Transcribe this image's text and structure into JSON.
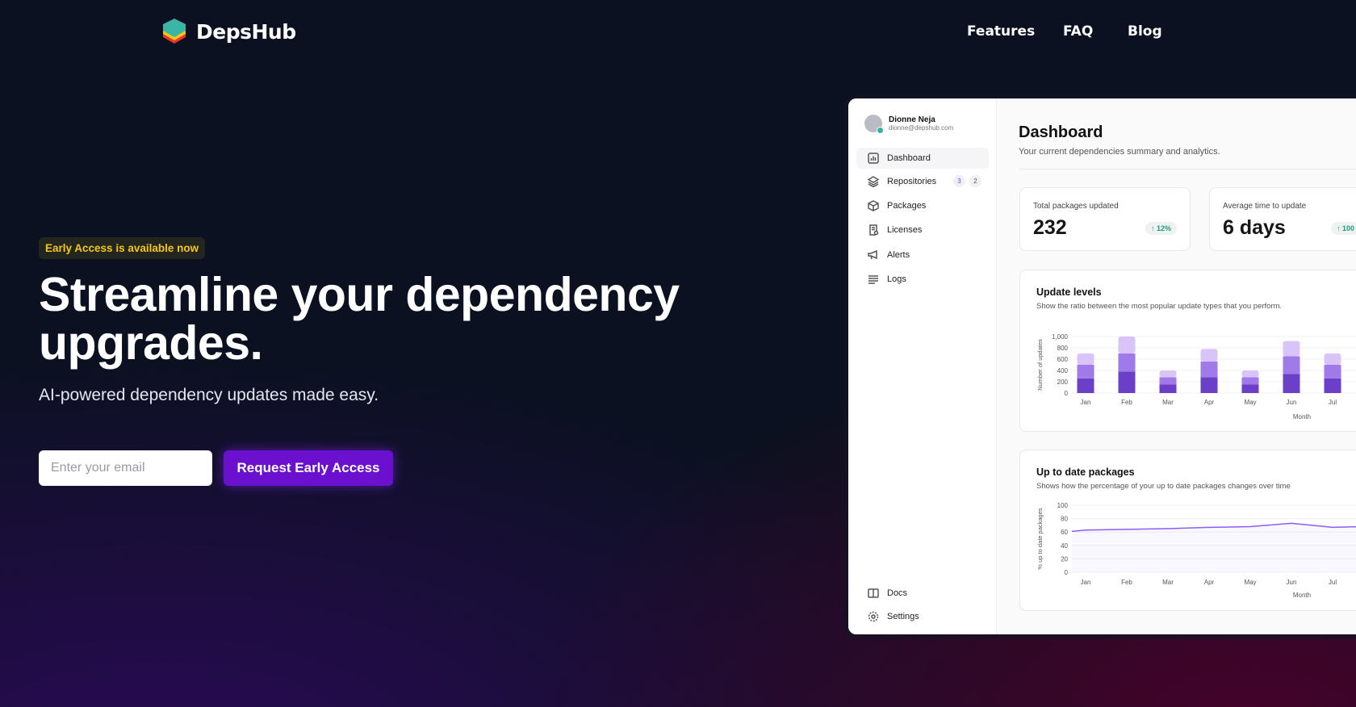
{
  "brand": {
    "name": "DepsHub",
    "logo_colors": [
      "#3bb5a5",
      "#f5c518",
      "#e8352a"
    ]
  },
  "nav": {
    "items": [
      "Features",
      "FAQ",
      "Blog"
    ]
  },
  "hero": {
    "badge": "Early Access is available now",
    "title_line1": "Streamline your dependency",
    "title_line2": "upgrades.",
    "subtitle": "AI-powered dependency updates made easy.",
    "email_placeholder": "Enter your email",
    "cta": "Request Early Access"
  },
  "colors": {
    "accent": "#6b10cf",
    "badge_text": "#f5c518",
    "bar_dark": "#6c3fc9",
    "bar_mid": "#a07ae8",
    "bar_light": "#d9c4f7",
    "line": "#8b5cf6"
  },
  "dashboard": {
    "user": {
      "name": "Dionne Neja",
      "email": "dionne@depshub.com"
    },
    "sidebar": [
      {
        "label": "Dashboard",
        "icon": "bar-chart-icon",
        "active": true
      },
      {
        "label": "Repositories",
        "icon": "layers-icon",
        "badges": [
          "3",
          "2"
        ]
      },
      {
        "label": "Packages",
        "icon": "package-icon"
      },
      {
        "label": "Licenses",
        "icon": "license-icon"
      },
      {
        "label": "Alerts",
        "icon": "megaphone-icon"
      },
      {
        "label": "Logs",
        "icon": "list-icon"
      }
    ],
    "sidebar_bottom": [
      {
        "label": "Docs",
        "icon": "book-icon"
      },
      {
        "label": "Settings",
        "icon": "gear-icon"
      }
    ],
    "title": "Dashboard",
    "subtitle": "Your current dependencies summary and analytics.",
    "stats": [
      {
        "label": "Total packages updated",
        "value": "232",
        "delta": "12%"
      },
      {
        "label": "Average time to update",
        "value": "6 days",
        "delta": "100"
      }
    ],
    "update_levels": {
      "title": "Update levels",
      "subtitle": "Show the ratio between the most popular update types that you perform."
    },
    "up_to_date": {
      "title": "Up to date packages",
      "subtitle": "Shows how the percentage of your up to date packages changes over time"
    }
  },
  "chart_data": [
    {
      "type": "bar",
      "stacked": true,
      "categories": [
        "Jan",
        "Feb",
        "Mar",
        "Apr",
        "May",
        "Jun",
        "Jul"
      ],
      "series": [
        {
          "values": [
            260,
            380,
            150,
            280,
            150,
            340,
            260
          ]
        },
        {
          "values": [
            240,
            320,
            130,
            280,
            130,
            310,
            240
          ]
        },
        {
          "values": [
            200,
            300,
            120,
            220,
            120,
            270,
            200
          ]
        }
      ],
      "xlabel": "Month",
      "ylabel": "Number of updates",
      "yticks": [
        "0",
        "200",
        "400",
        "600",
        "800",
        "1,000"
      ],
      "ylim": [
        0,
        1000
      ],
      "grid": true
    },
    {
      "type": "line",
      "categories": [
        "Jan",
        "Feb",
        "Mar",
        "Apr",
        "May",
        "Jun",
        "Jul"
      ],
      "series": [
        {
          "values": [
            63,
            64,
            65,
            67,
            68,
            73,
            67
          ]
        }
      ],
      "start_value": 61,
      "end_value": 71,
      "xlabel": "Month",
      "ylabel": "% up to date packages",
      "yticks": [
        "0",
        "20",
        "40",
        "60",
        "80",
        "100"
      ],
      "ylim": [
        0,
        100
      ],
      "grid": true
    }
  ]
}
